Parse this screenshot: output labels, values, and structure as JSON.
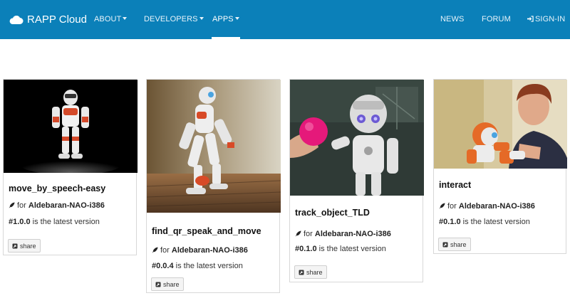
{
  "nav": {
    "brand": "RAPP Cloud",
    "about": "ABOUT",
    "developers": "DEVELOPERS",
    "apps": "APPS",
    "news": "NEWS",
    "forum": "FORUM",
    "signin": "SIGN-IN"
  },
  "cards": [
    {
      "title": "move_by_speech-easy",
      "for_prefix": "for",
      "platform": "Aldebaran-NAO-i386",
      "version_hash": "#",
      "version": "1.0.0",
      "version_suffix": "is the latest version",
      "share": "share"
    },
    {
      "title": "find_qr_speak_and_move",
      "for_prefix": "for",
      "platform": "Aldebaran-NAO-i386",
      "version_hash": "#",
      "version": "0.0.4",
      "version_suffix": "is the latest version",
      "share": "share"
    },
    {
      "title": "track_object_TLD",
      "for_prefix": "for",
      "platform": "Aldebaran-NAO-i386",
      "version_hash": "#",
      "version": "0.1.0",
      "version_suffix": "is the latest version",
      "share": "share"
    },
    {
      "title": "interact",
      "for_prefix": "for",
      "platform": "Aldebaran-NAO-i386",
      "version_hash": "#",
      "version": "0.1.0",
      "version_suffix": "is the latest version",
      "share": "share"
    }
  ],
  "colors": {
    "navbar": "#0b80b9",
    "robot_orange": "#e04a1e"
  },
  "icons": {
    "brand": "cloud-icon",
    "signin": "sign-in-icon",
    "platform": "rocket-icon",
    "share": "share-icon"
  }
}
